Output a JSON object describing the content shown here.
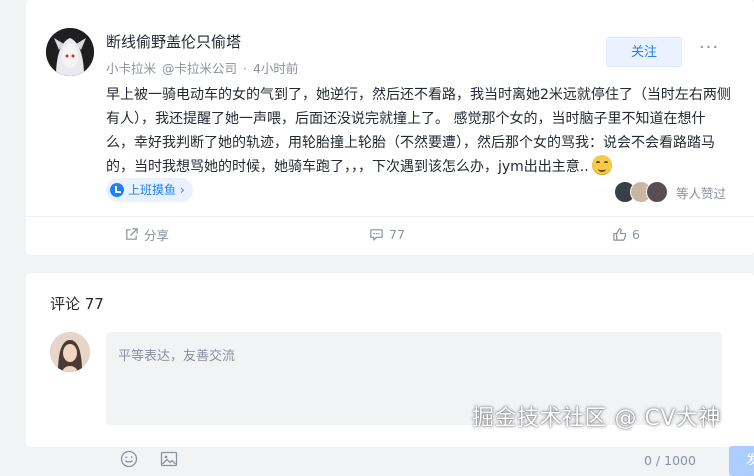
{
  "post": {
    "author_name": "断线偷野盖伦只偷塔",
    "author_meta": [
      "小卡拉米",
      "@卡拉米公司",
      "·",
      "4小时前"
    ],
    "follow_label": "关注",
    "more_label": "···",
    "content": "早上被一骑电动车的女的气到了，她逆行，然后还不看路，我当时离她2米远就停住了（当时左右两侧有人），我还提醒了她一声喂，后面还没说完就撞上了。 感觉那个女的，当时脑子里不知道在想什么，幸好我判断了她的轨迹，用轮胎撞上轮胎（不然要遭），然后那个女的骂我：说会不会看路踏马的，当时我想骂她的时候，她骑车跑了，，，下次遇到该怎么办，jym出出主意..",
    "topic_tag": "上班摸鱼 ›",
    "likers_text": "等人赞过",
    "actions": {
      "share_label": "分享",
      "comment_count": "77",
      "like_count": "6"
    }
  },
  "comments": {
    "title": "评论 77",
    "placeholder": "平等表达，友善交流",
    "char_count": "0 / 1000",
    "send_label": "发送"
  },
  "watermark": "掘金技术社区 @ CV大神",
  "colors": {
    "accent": "#1e80ff",
    "page_bg": "#f2f3f5",
    "muted_text": "#8a919f",
    "send_disabled": "#abcdff"
  },
  "icons": [
    "share-icon",
    "comment-icon",
    "like-icon",
    "emoji-icon",
    "image-icon",
    "more-icon"
  ]
}
